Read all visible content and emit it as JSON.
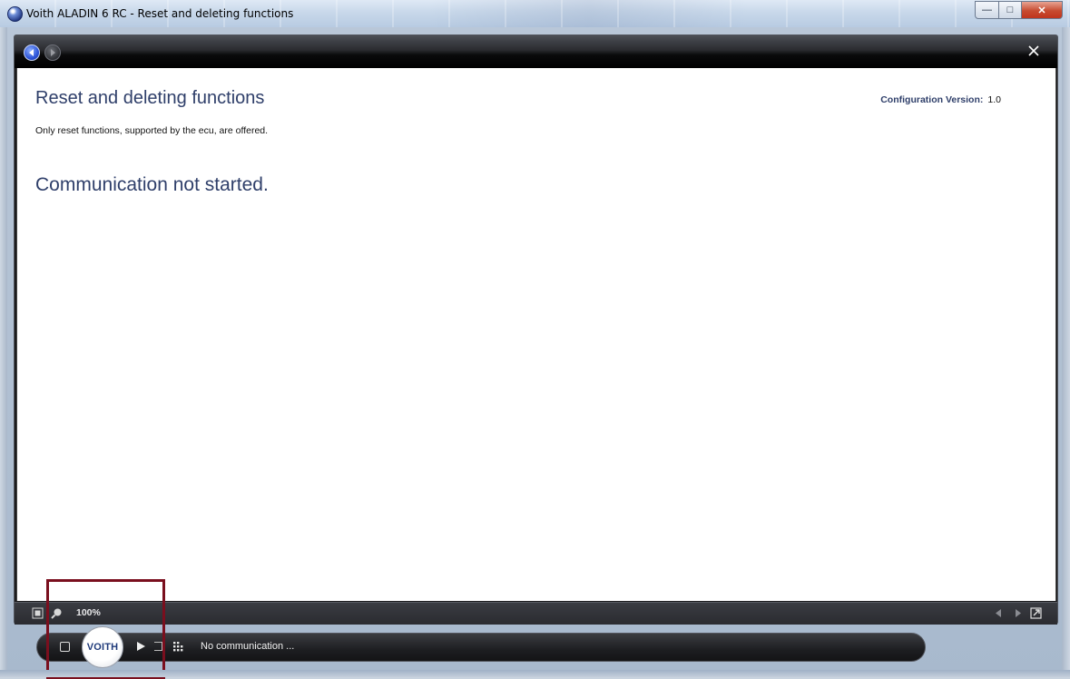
{
  "window": {
    "title": "Voith ALADIN 6 RC - Reset and deleting functions",
    "minimize_glyph": "—",
    "maximize_glyph": "□",
    "close_glyph": "✕"
  },
  "page": {
    "title": "Reset and deleting functions",
    "subtitle": "Only reset functions, supported by the ecu, are offered.",
    "config_label": "Configuration Version:",
    "config_value": "1.0",
    "status_message": "Communication not started."
  },
  "status_bar": {
    "zoom": "100%"
  },
  "taskbar": {
    "brand": "VOITH",
    "communication_status": "No communication ..."
  },
  "icons": {
    "back": "back-arrow-icon",
    "forward": "forward-arrow-icon",
    "close": "close-icon",
    "fit": "fit-screen-icon",
    "magnifier": "magnifier-icon",
    "prev": "prev-page-icon",
    "next": "next-page-icon",
    "popout": "popout-icon",
    "play": "play-icon",
    "stop": "stop-icon",
    "grid": "grid-icon"
  },
  "colors": {
    "title_text": "#2f3f6a",
    "highlight": "#7a0f1e",
    "app_chrome": "#1b1b1d"
  }
}
